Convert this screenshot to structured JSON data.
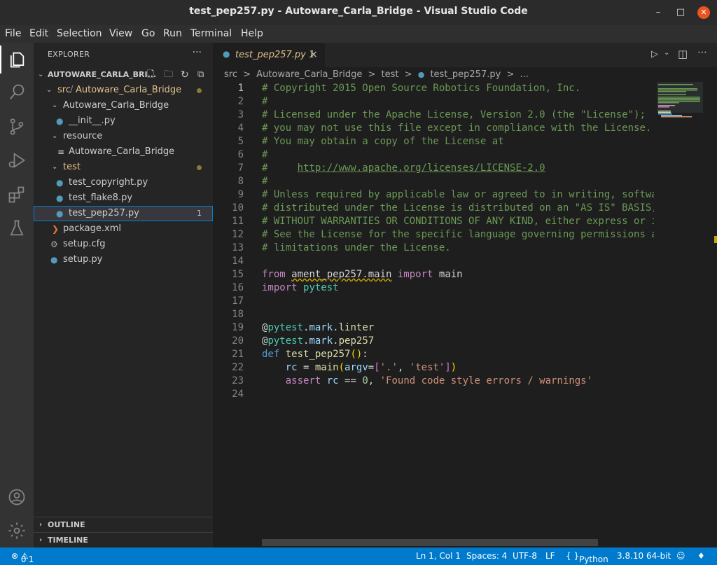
{
  "window": {
    "title": "test_pep257.py - Autoware_Carla_Bridge - Visual Studio Code"
  },
  "menu": [
    "File",
    "Edit",
    "Selection",
    "View",
    "Go",
    "Run",
    "Terminal",
    "Help"
  ],
  "sidebar": {
    "header": "EXPLORER",
    "more": "···",
    "root": "AUTOWARE_CARLA_BRI...",
    "tree": [
      {
        "label_a": "src",
        "label_b": "Autoware_Carla_Bridge",
        "kind": "folder-open"
      },
      {
        "label": "Autoware_Carla_Bridge",
        "kind": "folder-open"
      },
      {
        "label": "__init__.py",
        "kind": "py"
      },
      {
        "label": "resource",
        "kind": "folder-open"
      },
      {
        "label": "Autoware_Carla_Bridge",
        "kind": "file"
      },
      {
        "label": "test",
        "kind": "folder-open"
      },
      {
        "label": "test_copyright.py",
        "kind": "py"
      },
      {
        "label": "test_flake8.py",
        "kind": "py"
      },
      {
        "label": "test_pep257.py",
        "kind": "py",
        "badge": "1"
      },
      {
        "label": "package.xml",
        "kind": "xml"
      },
      {
        "label": "setup.cfg",
        "kind": "gear"
      },
      {
        "label": "setup.py",
        "kind": "py"
      }
    ],
    "sections": {
      "outline": "OUTLINE",
      "timeline": "TIMELINE"
    }
  },
  "tab": {
    "label": "test_pep257.py",
    "modified": "1",
    "close": "×"
  },
  "breadcrumb": [
    "src",
    ">",
    "Autoware_Carla_Bridge",
    ">",
    "test",
    ">",
    "test_pep257.py",
    ">",
    "..."
  ],
  "code": {
    "lines": [
      [
        [
          "com",
          "# Copyright 2015 Open Source Robotics Foundation, Inc."
        ]
      ],
      [
        [
          "com",
          "#"
        ]
      ],
      [
        [
          "com",
          "# Licensed under the Apache License, Version 2.0 (the \"License\");"
        ]
      ],
      [
        [
          "com",
          "# you may not use this file except in compliance with the License."
        ]
      ],
      [
        [
          "com",
          "# You may obtain a copy of the License at"
        ]
      ],
      [
        [
          "com",
          "#"
        ]
      ],
      [
        [
          "com",
          "#     "
        ],
        [
          "url",
          "http://www.apache.org/licenses/LICENSE-2.0"
        ]
      ],
      [
        [
          "com",
          "#"
        ]
      ],
      [
        [
          "com",
          "# Unless required by applicable law or agreed to in writing, softwa"
        ]
      ],
      [
        [
          "com",
          "# distributed under the License is distributed on an \"AS IS\" BASIS,"
        ]
      ],
      [
        [
          "com",
          "# WITHOUT WARRANTIES OR CONDITIONS OF ANY KIND, either express or i"
        ]
      ],
      [
        [
          "com",
          "# See the License for the specific language governing permissions a"
        ]
      ],
      [
        [
          "com",
          "# limitations under the License."
        ]
      ],
      [],
      [
        [
          "kw",
          "from "
        ],
        [
          "warn",
          "ament_pep257.main"
        ],
        [
          "kw",
          " import "
        ],
        [
          "pl",
          "main"
        ]
      ],
      [
        [
          "kw",
          "import "
        ],
        [
          "cls",
          "pytest"
        ]
      ],
      [],
      [],
      [
        [
          "pl",
          "@"
        ],
        [
          "cls",
          "pytest"
        ],
        [
          "pl",
          "."
        ],
        [
          "var",
          "mark"
        ],
        [
          "pl",
          "."
        ],
        [
          "fn",
          "linter"
        ]
      ],
      [
        [
          "pl",
          "@"
        ],
        [
          "cls",
          "pytest"
        ],
        [
          "pl",
          "."
        ],
        [
          "var",
          "mark"
        ],
        [
          "pl",
          "."
        ],
        [
          "fn",
          "pep257"
        ]
      ],
      [
        [
          "def",
          "def "
        ],
        [
          "fn",
          "test_pep257"
        ],
        [
          "br",
          "()"
        ],
        [
          "pl",
          ":"
        ]
      ],
      [
        [
          "pl",
          "    "
        ],
        [
          "var",
          "rc"
        ],
        [
          "pl",
          " = "
        ],
        [
          "fn",
          "main"
        ],
        [
          "br",
          "("
        ],
        [
          "var",
          "argv"
        ],
        [
          "pl",
          "="
        ],
        [
          "br2",
          "["
        ],
        [
          "str",
          "'.'"
        ],
        [
          "pl",
          ", "
        ],
        [
          "str",
          "'test'"
        ],
        [
          "br2",
          "]"
        ],
        [
          "br",
          ")"
        ]
      ],
      [
        [
          "pl",
          "    "
        ],
        [
          "kw",
          "assert "
        ],
        [
          "var",
          "rc"
        ],
        [
          "pl",
          " == "
        ],
        [
          "num",
          "0"
        ],
        [
          "pl",
          ", "
        ],
        [
          "str",
          "'Found code style errors / warnings'"
        ]
      ],
      []
    ]
  },
  "status": {
    "errors": "0",
    "warnings": "1",
    "position": "Ln 1, Col 1",
    "spaces": "Spaces: 4",
    "encoding": "UTF-8",
    "eol": "LF",
    "language": "Python",
    "interpreter": "3.8.10 64-bit"
  }
}
